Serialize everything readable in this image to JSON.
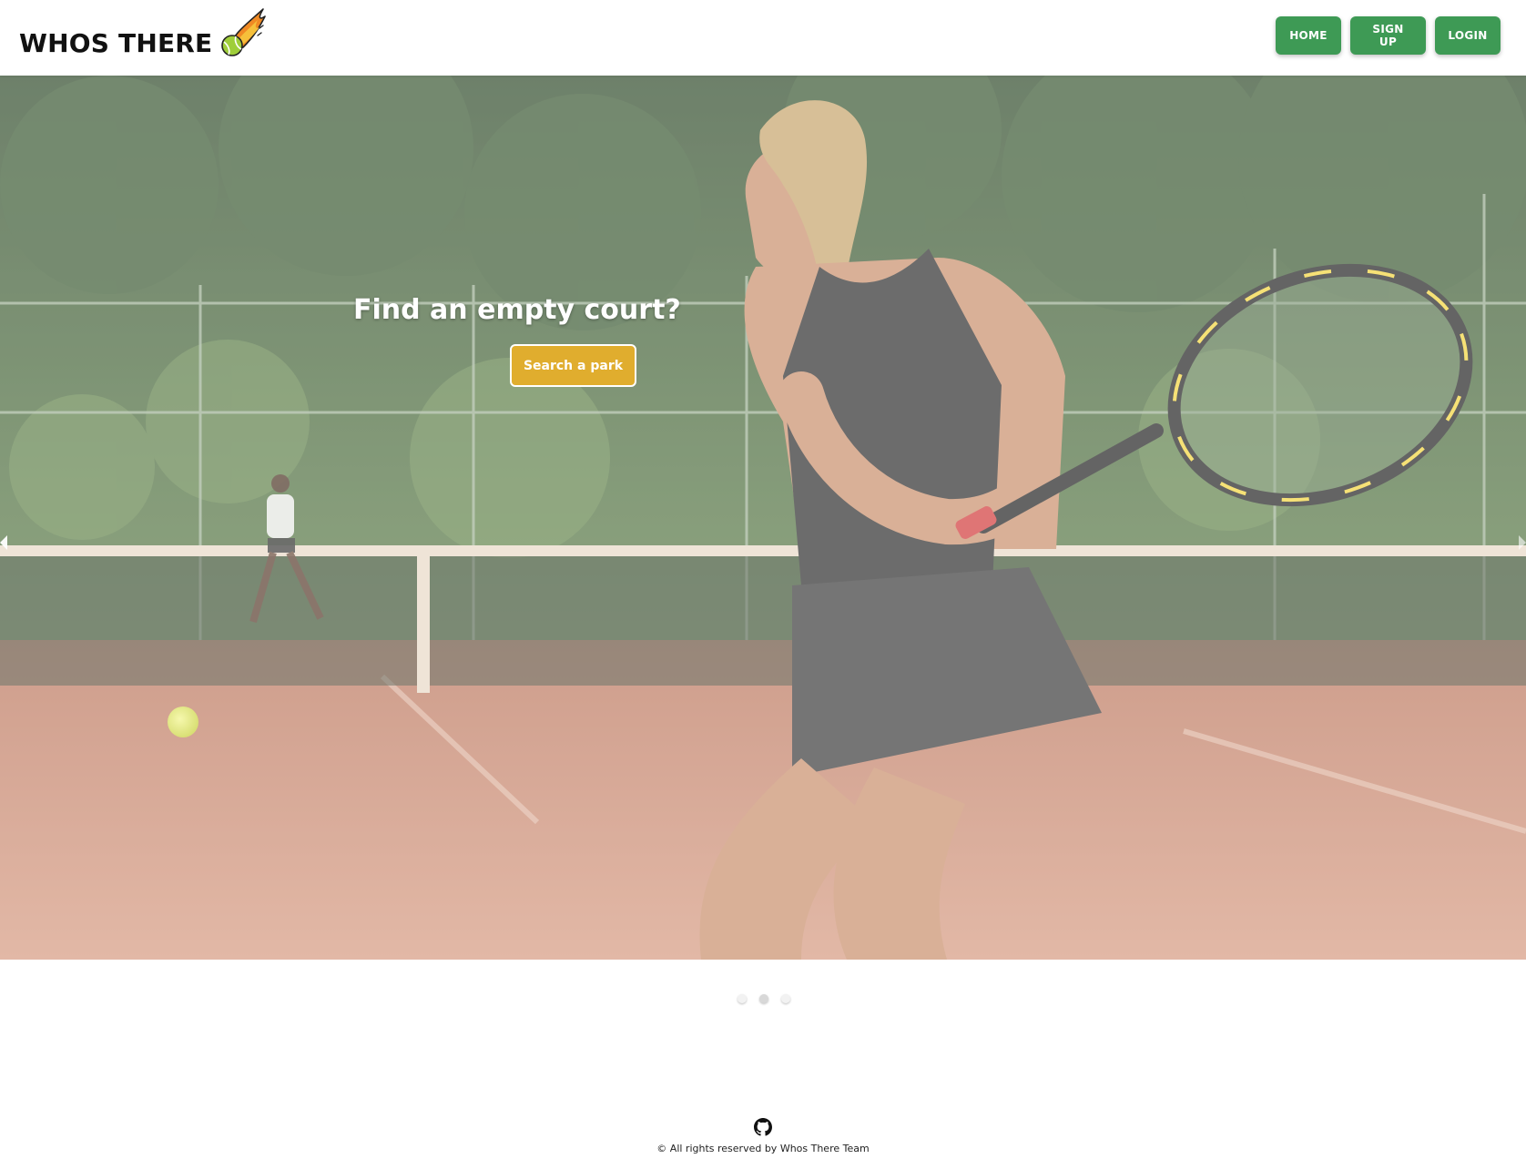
{
  "header": {
    "brand": "WHOS THERE",
    "brand_icon": "flaming-tennis-ball-icon",
    "nav": [
      {
        "label": "HOME"
      },
      {
        "label": "SIGN UP"
      },
      {
        "label": "LOGIN"
      }
    ]
  },
  "hero": {
    "title": "Find an empty court?",
    "cta_label": "Search a park",
    "image": "tennis-player-backhand-photo",
    "slides": 3,
    "active_slide": 2
  },
  "footer": {
    "icon": "github-icon",
    "copyright": "© All rights reserved by Whos There Team"
  },
  "colors": {
    "nav_button": "#3e9a55",
    "cta_button": "#e0ad2e",
    "header_bg": "#ffffff"
  }
}
